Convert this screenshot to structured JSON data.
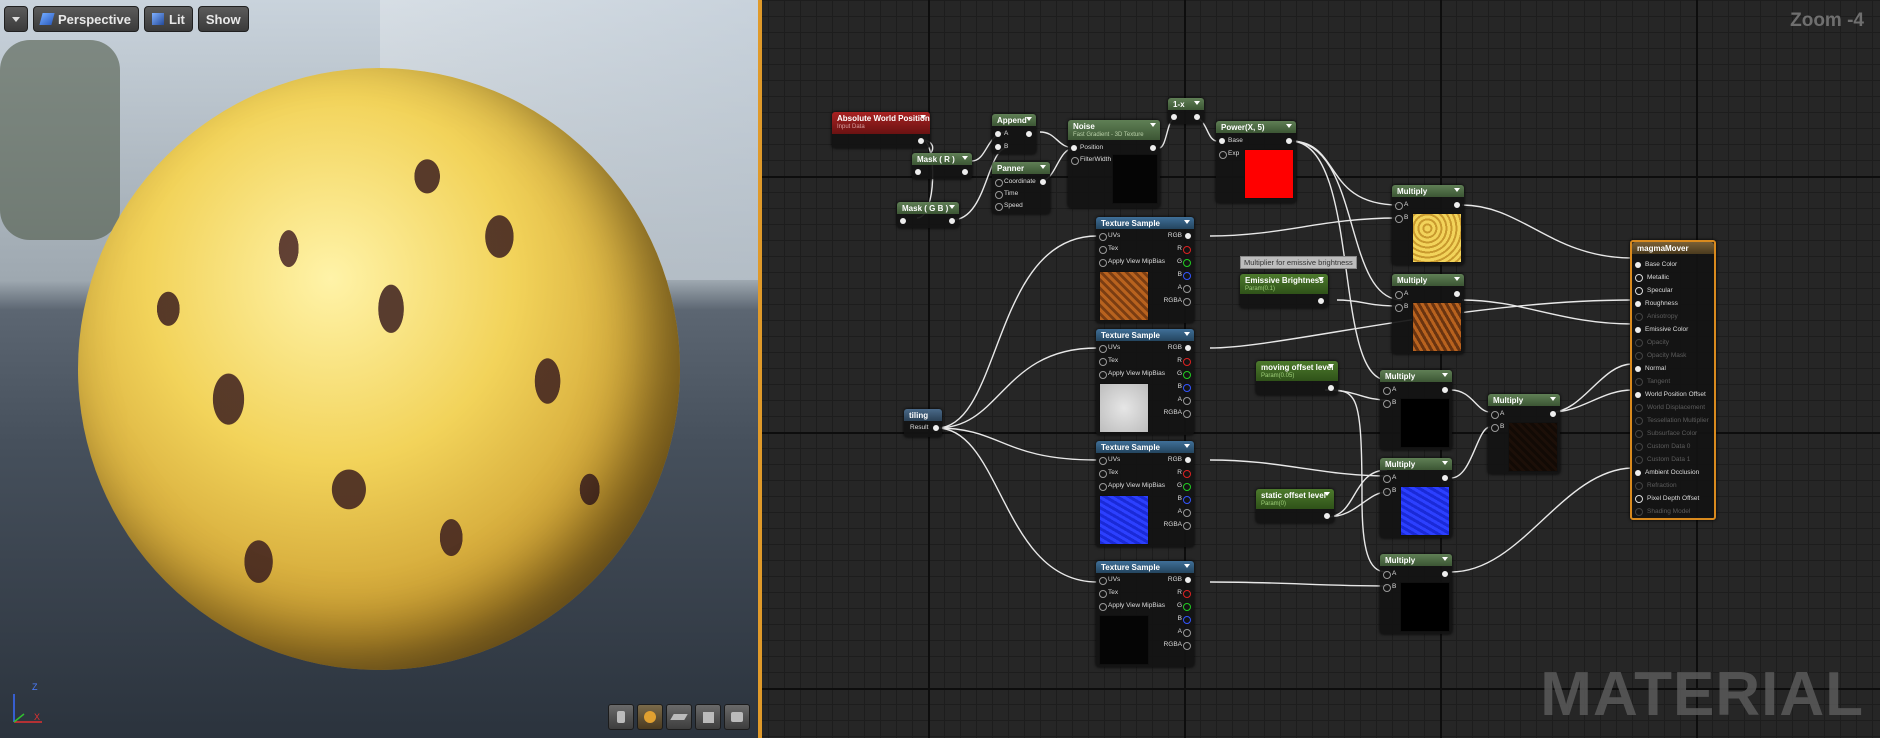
{
  "viewport": {
    "toolbar": {
      "dropdown_icon": "chevron-down-icon",
      "perspective_label": "Perspective",
      "lit_label": "Lit",
      "show_label": "Show"
    },
    "axes": {
      "z": "Z",
      "x": "X"
    },
    "bottom_buttons": [
      "preview-cylinder-icon",
      "preview-sphere-icon",
      "preview-plane-icon",
      "preview-cube-icon",
      "preview-mesh-icon"
    ]
  },
  "graph": {
    "zoom_label": "Zoom -4",
    "watermark": "MATERIAL",
    "nodes": {
      "abs_world_pos": {
        "title": "Absolute World Position",
        "subtitle": "Input Data"
      },
      "append": {
        "title": "Append",
        "pins": [
          "A",
          "B"
        ]
      },
      "mask_r": {
        "title": "Mask ( R )"
      },
      "mask_gb": {
        "title": "Mask ( G B )"
      },
      "panner": {
        "title": "Panner",
        "pins": [
          "Coordinate",
          "Time",
          "Speed"
        ]
      },
      "noise": {
        "title": "Noise",
        "subtitle": "Fast Gradient - 3D Texture",
        "pins": [
          "Position",
          "FilterWidth"
        ]
      },
      "one_minus": {
        "title": "1-x"
      },
      "power": {
        "title": "Power(X, 5)",
        "pins": [
          "Base",
          "Exp"
        ]
      },
      "texture_sample_title": "Texture Sample",
      "texture_pins": [
        "UVs",
        "Tex",
        "Apply View MipBias"
      ],
      "texture_outputs": [
        "RGB",
        "R",
        "G",
        "B",
        "A",
        "RGBA"
      ],
      "tiling": {
        "title": "tiling",
        "output": "Result"
      },
      "comment": "Multiplier for emissive brightness",
      "emissive": {
        "title": "Emissive Brightness",
        "subtitle": "Param(0.1)"
      },
      "moving": {
        "title": "moving offset level",
        "subtitle": "Param(0.05)"
      },
      "static": {
        "title": "static offset level",
        "subtitle": "Param(0)"
      },
      "multiply_title": "Multiply",
      "multiply_pins": [
        "A",
        "B"
      ],
      "result": {
        "title": "magmaMover",
        "pins": [
          "Base Color",
          "Metallic",
          "Specular",
          "Roughness",
          "Anisotropy",
          "Emissive Color",
          "Opacity",
          "Opacity Mask",
          "Normal",
          "Tangent",
          "World Position Offset",
          "World Displacement",
          "Tessellation Multiplier",
          "Subsurface Color",
          "Custom Data 0",
          "Custom Data 1",
          "Ambient Occlusion",
          "Refraction",
          "Pixel Depth Offset",
          "Shading Model"
        ]
      }
    }
  },
  "colors": {
    "divider": "#e09a2a",
    "sphere_yellow": "#f2d35a",
    "power_preview": "#ff0000",
    "normal_blue": "#1a2ad8"
  }
}
